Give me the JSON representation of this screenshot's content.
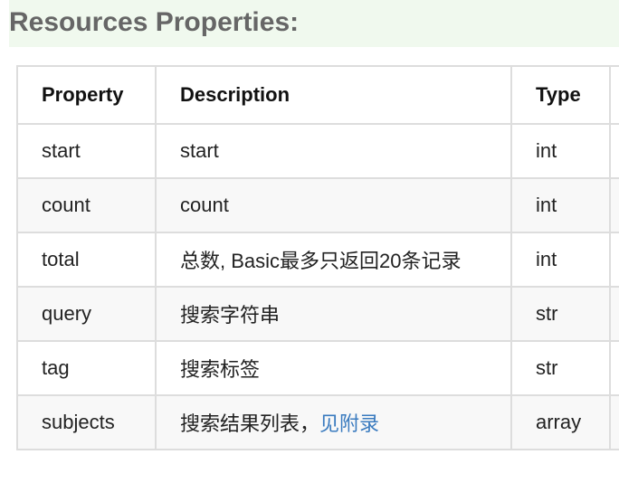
{
  "section": {
    "title": "Resources Properties:"
  },
  "table": {
    "headers": [
      "Property",
      "Description",
      "Type"
    ],
    "rows": [
      {
        "property": "start",
        "description": "start",
        "type": "int"
      },
      {
        "property": "count",
        "description": "count",
        "type": "int"
      },
      {
        "property": "total",
        "description": "总数, Basic最多只返回20条记录",
        "type": "int"
      },
      {
        "property": "query",
        "description": "搜索字符串",
        "type": "str"
      },
      {
        "property": "tag",
        "description": "搜索标签",
        "type": "str"
      },
      {
        "property": "subjects",
        "description": "搜索结果列表，",
        "description_link": "见附录",
        "type": "array"
      }
    ]
  },
  "colors": {
    "header_bg": "#f0f9ee",
    "title": "#666666",
    "border": "#dddddd",
    "link": "#3a7bbf",
    "stripe": "#f8f8f8"
  }
}
